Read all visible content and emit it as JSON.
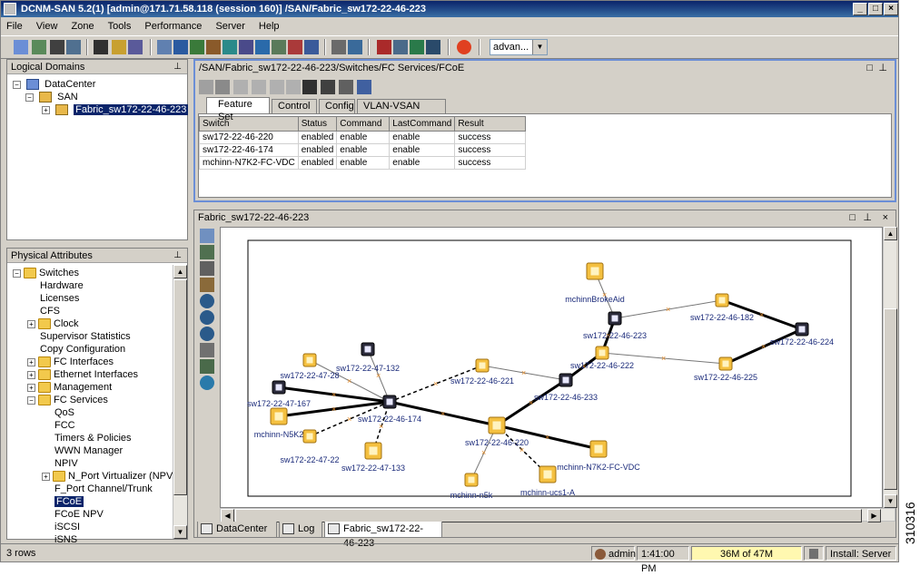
{
  "window": {
    "title": "DCNM-SAN 5.2(1) [admin@171.71.58.118 (session 160)] /SAN/Fabric_sw172-22-46-223",
    "controls": [
      "_",
      "□",
      "×"
    ]
  },
  "menu": [
    "File",
    "View",
    "Zone",
    "Tools",
    "Performance",
    "Server",
    "Help"
  ],
  "toolbar": {
    "combo_value": "advan..."
  },
  "logical_domains": {
    "title": "Logical Domains",
    "items": [
      {
        "label": "DataCenter"
      },
      {
        "label": "SAN"
      },
      {
        "label": "Fabric_sw172-22-46-223",
        "selected": true
      }
    ]
  },
  "physical_attributes": {
    "title": "Physical Attributes",
    "items": [
      {
        "label": "Switches"
      },
      {
        "label": "Hardware"
      },
      {
        "label": "Licenses"
      },
      {
        "label": "CFS"
      },
      {
        "label": "Clock"
      },
      {
        "label": "Supervisor Statistics"
      },
      {
        "label": "Copy Configuration"
      },
      {
        "label": "FC Interfaces"
      },
      {
        "label": "Ethernet Interfaces"
      },
      {
        "label": "Management"
      },
      {
        "label": "FC Services"
      },
      {
        "label": "QoS"
      },
      {
        "label": "FCC"
      },
      {
        "label": "Timers & Policies"
      },
      {
        "label": "WWN Manager"
      },
      {
        "label": "NPIV"
      },
      {
        "label": "N_Port Virtualizer (NPV)"
      },
      {
        "label": "F_Port Channel/Trunk"
      },
      {
        "label": "FCoE",
        "selected": true
      },
      {
        "label": "FCoE NPV"
      },
      {
        "label": "iSCSI"
      },
      {
        "label": "iSNS"
      }
    ]
  },
  "fcoe_panel": {
    "path": "/SAN/Fabric_sw172-22-46-223/Switches/FC Services/FCoE",
    "tabs": [
      "Feature Set",
      "Control",
      "Config",
      "VLAN-VSAN Mapping"
    ],
    "active_tab": "Feature Set",
    "columns": [
      "Switch",
      "Status",
      "Command",
      "LastCommand",
      "Result"
    ],
    "rows": [
      [
        "sw172-22-46-220",
        "enabled",
        "enable",
        "enable",
        "success"
      ],
      [
        "sw172-22-46-174",
        "enabled",
        "enable",
        "enable",
        "success"
      ],
      [
        "mchinn-N7K2-FC-VDC",
        "enabled",
        "enable",
        "enable",
        "success"
      ]
    ]
  },
  "map_panel": {
    "title": "Fabric_sw172-22-46-223",
    "nodes": [
      {
        "id": "mchinnBrokeAid",
        "label": "mchinnBrokeAid",
        "kind": "host"
      },
      {
        "id": "sw223",
        "label": "sw172-22-46-223",
        "kind": "switch-dark"
      },
      {
        "id": "sw182",
        "label": "sw172-22-46-182",
        "kind": "switch-yellow"
      },
      {
        "id": "sw224",
        "label": "sw172-22-46-224",
        "kind": "switch-dark"
      },
      {
        "id": "sw222",
        "label": "sw172-22-46-222",
        "kind": "switch-yellow"
      },
      {
        "id": "sw225",
        "label": "sw172-22-46-225",
        "kind": "switch-yellow"
      },
      {
        "id": "sw221",
        "label": "sw172-22-46-221",
        "kind": "switch-yellow"
      },
      {
        "id": "sw233",
        "label": "sw172-22-46-233",
        "kind": "switch-dark"
      },
      {
        "id": "sw132",
        "label": "sw172-22-47-132",
        "kind": "switch-dark"
      },
      {
        "id": "sw28",
        "label": "sw172-22-47-28",
        "kind": "switch-yellow"
      },
      {
        "id": "sw167",
        "label": "sw172-22-47-167",
        "kind": "switch-dark"
      },
      {
        "id": "sw174",
        "label": "sw172-22-46-174",
        "kind": "switch-dark"
      },
      {
        "id": "n5k2",
        "label": "mchinn-N5K2",
        "kind": "host"
      },
      {
        "id": "sw22",
        "label": "sw172-22-47-22",
        "kind": "switch-yellow"
      },
      {
        "id": "sw133",
        "label": "sw172-22-47-133",
        "kind": "host"
      },
      {
        "id": "sw220",
        "label": "sw172-22-46-220",
        "kind": "host"
      },
      {
        "id": "n7k2",
        "label": "mchinn-N7K2-FC-VDC",
        "kind": "host"
      },
      {
        "id": "n5k",
        "label": "mchinn-n5k",
        "kind": "switch-yellow"
      },
      {
        "id": "ucs",
        "label": "mchinn-ucs1-A",
        "kind": "host"
      }
    ],
    "links": [
      {
        "from": "mchinnBrokeAid",
        "to": "sw223",
        "style": "thin"
      },
      {
        "from": "sw223",
        "to": "sw182",
        "style": "thin"
      },
      {
        "from": "sw182",
        "to": "sw224",
        "style": "thick"
      },
      {
        "from": "sw222",
        "to": "sw225",
        "style": "thin"
      },
      {
        "from": "sw225",
        "to": "sw224",
        "style": "thick"
      },
      {
        "from": "sw223",
        "to": "sw222",
        "style": "thick"
      },
      {
        "from": "sw222",
        "to": "sw233",
        "style": "thick"
      },
      {
        "from": "sw233",
        "to": "sw220",
        "style": "thick"
      },
      {
        "from": "sw221",
        "to": "sw233",
        "style": "thin"
      },
      {
        "from": "sw174",
        "to": "sw221",
        "style": "dashed"
      },
      {
        "from": "sw174",
        "to": "sw220",
        "style": "thick"
      },
      {
        "from": "sw174",
        "to": "sw132",
        "style": "thin"
      },
      {
        "from": "sw174",
        "to": "sw28",
        "style": "thin"
      },
      {
        "from": "sw167",
        "to": "sw174",
        "style": "thick"
      },
      {
        "from": "n5k2",
        "to": "sw174",
        "style": "thick"
      },
      {
        "from": "sw22",
        "to": "sw174",
        "style": "dashed"
      },
      {
        "from": "sw133",
        "to": "sw174",
        "style": "dashed"
      },
      {
        "from": "sw220",
        "to": "n7k2",
        "style": "thick"
      },
      {
        "from": "sw220",
        "to": "n5k",
        "style": "thin"
      },
      {
        "from": "sw220",
        "to": "ucs",
        "style": "dashed"
      }
    ]
  },
  "bottom_tabs": [
    "DataCenter",
    "Log",
    "Fabric_sw172-22-46-223"
  ],
  "status": {
    "rows": "3 rows",
    "user": "admin",
    "time": "1:41:00 PM",
    "memory": "36M of 47M",
    "install": "Install: Server"
  },
  "side_label": "310316"
}
